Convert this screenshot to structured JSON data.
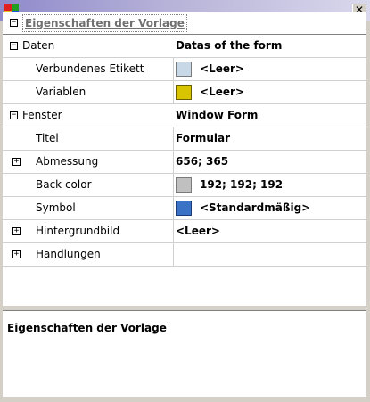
{
  "window": {
    "title": "",
    "close_glyph": "✕"
  },
  "header": {
    "expander": "−",
    "title": "Eigenschaften der Vorlage"
  },
  "rows": [
    {
      "kind": "category",
      "expander": "−",
      "name": "Daten",
      "value": "Datas of the form"
    },
    {
      "kind": "prop",
      "name": "Verbundenes Etikett",
      "icon": "label-icon",
      "value": "<Leer>"
    },
    {
      "kind": "prop",
      "name": "Variablen",
      "icon": "variable-icon",
      "value": "<Leer>"
    },
    {
      "kind": "category",
      "expander": "−",
      "name": "Fenster",
      "value": "Window Form"
    },
    {
      "kind": "prop",
      "name": "Titel",
      "value": "Formular"
    },
    {
      "kind": "sub",
      "expander": "+",
      "name": "Abmessung",
      "value": "656; 365"
    },
    {
      "kind": "prop",
      "name": "Back color",
      "swatch": "#c0c0c0",
      "value": "192; 192; 192"
    },
    {
      "kind": "prop",
      "name": "Symbol",
      "icon": "form-symbol-icon",
      "value": "<Standardmäßig>"
    },
    {
      "kind": "sub",
      "expander": "+",
      "name": "Hintergrundbild",
      "value": "<Leer>"
    },
    {
      "kind": "sub",
      "expander": "+",
      "name": "Handlungen",
      "value": ""
    }
  ],
  "description": {
    "title": "Eigenschaften der Vorlage"
  },
  "colors": {
    "titlebar_start": "#8f8acb",
    "titlebar_end": "#d9d8ec",
    "swatch": "#c0c0c0"
  }
}
